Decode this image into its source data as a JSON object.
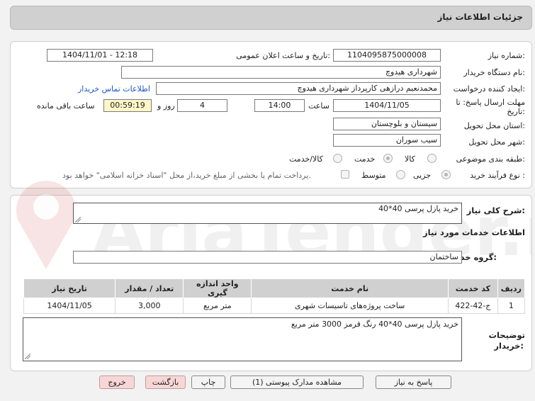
{
  "header": {
    "title": "جزئیات اطلاعات نیاز"
  },
  "form": {
    "need_number_label": "شماره نیاز:",
    "need_number": "1104095875000008",
    "announce_label": "تاریخ و ساعت اعلان عمومی:",
    "announce_value": "1404/11/01 - 12:18",
    "buyer_org_label": "نام دستگاه خریدار:",
    "buyer_org": "شهرداری هیدوچ",
    "creator_label": "ایجاد کننده درخواست:",
    "creator": "محمدنعیم درازهی کارپرداز شهرداری هیدوچ",
    "contact_link": "اطلاعات تماس خریدار",
    "deadline_label_1": "مهلت ارسال پاسخ: تا",
    "deadline_label_2": "تاریخ:",
    "deadline_date": "1404/11/05",
    "time_label": "ساعت",
    "deadline_time": "14:00",
    "days_value": "4",
    "days_label": "روز و",
    "remaining_time": "00:59:19",
    "remaining_label": "ساعت باقی مانده",
    "province_label": "استان محل تحویل:",
    "province": "سیستان و بلوچستان",
    "city_label": "شهر محل تحویل:",
    "city": "سیب سوران",
    "category_label": "طبقه بندی موضوعی:",
    "category_options": [
      "کالا",
      "خدمت",
      "کالا/خدمت"
    ],
    "process_label": "نوع فرآیند خرید :",
    "process_options": [
      "جزیی",
      "متوسط"
    ],
    "payment_note": "پرداخت تمام یا بخشی از مبلغ خرید،از محل \"اسناد خزانه اسلامی\" خواهد بود."
  },
  "need": {
    "summary_label": "شرح کلی نیاز:",
    "summary": "خرید پازل پرسی 40*40",
    "services_title": "اطلاعات خدمات مورد نیاز",
    "group_label": "گروه خدمت:",
    "group_value": "ساختمان"
  },
  "table": {
    "headers": [
      "ردیف",
      "کد خدمت",
      "نام خدمت",
      "واحد اندازه گیری",
      "تعداد / مقدار",
      "تاریخ نیاز"
    ],
    "rows": [
      [
        "1",
        "ج-42-422",
        "ساخت پروژه‌های تاسیسات شهری",
        "متر مربع",
        "3,000",
        "1404/11/05"
      ]
    ]
  },
  "buyer_notes": {
    "label_1": "توضیحات",
    "label_2": "خریدار:",
    "text": "خرید پازل پرسی 40*40 رنگ قرمز 3000 متر مربع"
  },
  "buttons": {
    "reply": "پاسخ به نیاز",
    "attachments": "مشاهده مدارک پیوستی (1)",
    "print": "چاپ",
    "back": "بازگشت",
    "exit": "خروج"
  },
  "watermark": {
    "text": "AriaTender.neT"
  },
  "colors": {
    "header_bg": "#d0d0d0",
    "highlight": "#fff6c8",
    "link": "#1a55c8",
    "pink_button": "#f8d6d6"
  }
}
